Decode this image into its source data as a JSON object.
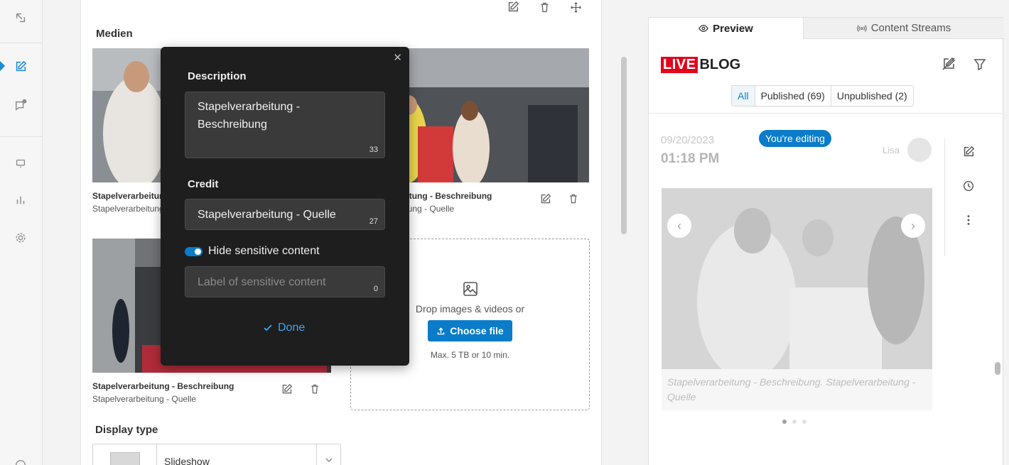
{
  "editor": {
    "section_media": "Medien",
    "media_items": [
      {
        "caption": "Stapelverarbeitung - Beschreibung",
        "credit": "Stapelverarbeitung - Quelle"
      },
      {
        "caption": "Stapelverarbeitung - Beschreibung",
        "credit": "Stapelverarbeitung - Quelle"
      },
      {
        "caption": "Stapelverarbeitung - Beschreibung",
        "credit": "Stapelverarbeitung - Quelle"
      }
    ],
    "dropzone": {
      "text": "Drop images & videos or",
      "button": "Choose file",
      "limit": "Max. 5 TB or 10 min."
    },
    "section_display": "Display type",
    "display_value": "Slideshow"
  },
  "popup": {
    "description_label": "Description",
    "description_value": "Stapelverarbeitung - Beschreibung",
    "description_count": "33",
    "credit_label": "Credit",
    "credit_value": "Stapelverarbeitung - Quelle",
    "credit_count": "27",
    "sensitive_label": "Hide sensitive content",
    "sensitive_on": true,
    "sensitive_placeholder": "Label of sensitive content",
    "sensitive_count": "0",
    "done": "Done"
  },
  "preview": {
    "tabs": [
      "Preview",
      "Content Streams"
    ],
    "logo_live": "LIVE",
    "logo_blog": "BLOG",
    "filters": [
      "All",
      "Published (69)",
      "Unpublished (2)"
    ],
    "post": {
      "date": "09/20/2023",
      "time": "01:18 PM",
      "badge": "You're editing",
      "author": "Lisa",
      "caption": "Stapelverarbeitung - Beschreibung. Stapelverarbeitung - Quelle",
      "slide_count": 3,
      "active_slide": 1
    }
  },
  "colors": {
    "accent": "#0a7cc9",
    "live_red": "#e3051b",
    "popup_bg": "#1e1e1e"
  }
}
